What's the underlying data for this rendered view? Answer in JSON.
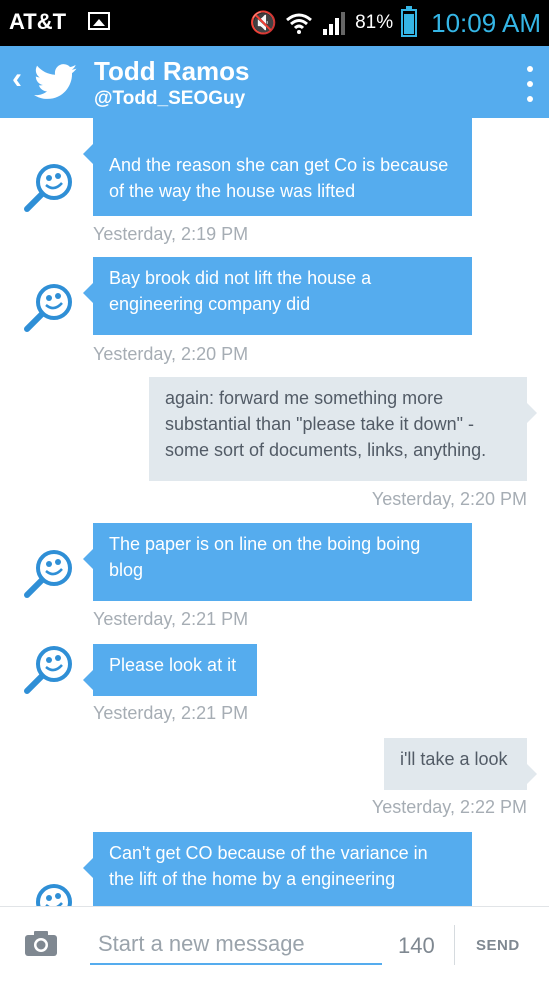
{
  "status_bar": {
    "carrier": "AT&T",
    "battery": "81%",
    "time": "10:09 AM",
    "icons": [
      "image-icon",
      "mute-icon",
      "wifi-icon",
      "signal-icon",
      "battery-icon"
    ]
  },
  "header": {
    "name": "Todd Ramos",
    "handle": "@Todd_SEOGuy",
    "icons": [
      "back-icon",
      "twitter-bird-icon",
      "more-options-icon"
    ]
  },
  "messages": [
    {
      "direction": "in",
      "text": "And the reason she can get Co is because of the way the house was lifted",
      "time": "Yesterday, 2:19 PM"
    },
    {
      "direction": "in",
      "text": "Bay brook did not lift the house a engineering company did",
      "time": "Yesterday, 2:20 PM"
    },
    {
      "direction": "out",
      "text": "again: forward me something more substantial than \"please take it down\" - some sort of documents, links, anything.",
      "time": "Yesterday, 2:20 PM"
    },
    {
      "direction": "in",
      "text": "The paper is on line on the boing boing blog",
      "time": "Yesterday, 2:21 PM"
    },
    {
      "direction": "in",
      "text": "Please look at it",
      "time": "Yesterday, 2:21 PM"
    },
    {
      "direction": "out",
      "text": "i'll take a look",
      "time": "Yesterday, 2:22 PM"
    },
    {
      "direction": "in",
      "text": "Can't get CO because of the variance in the lift of the home by a engineering",
      "time": ""
    }
  ],
  "composer": {
    "placeholder": "Start a new message",
    "value": "",
    "char_count": "140",
    "send_label": "SEND",
    "icons": [
      "camera-icon"
    ]
  },
  "colors": {
    "brand": "#55acee",
    "status_bar": "#000000",
    "incoming_bubble": "#55acee",
    "outgoing_bubble": "#e1e8ed",
    "timestamp": "#a6adb4",
    "clock": "#35b6e6"
  }
}
